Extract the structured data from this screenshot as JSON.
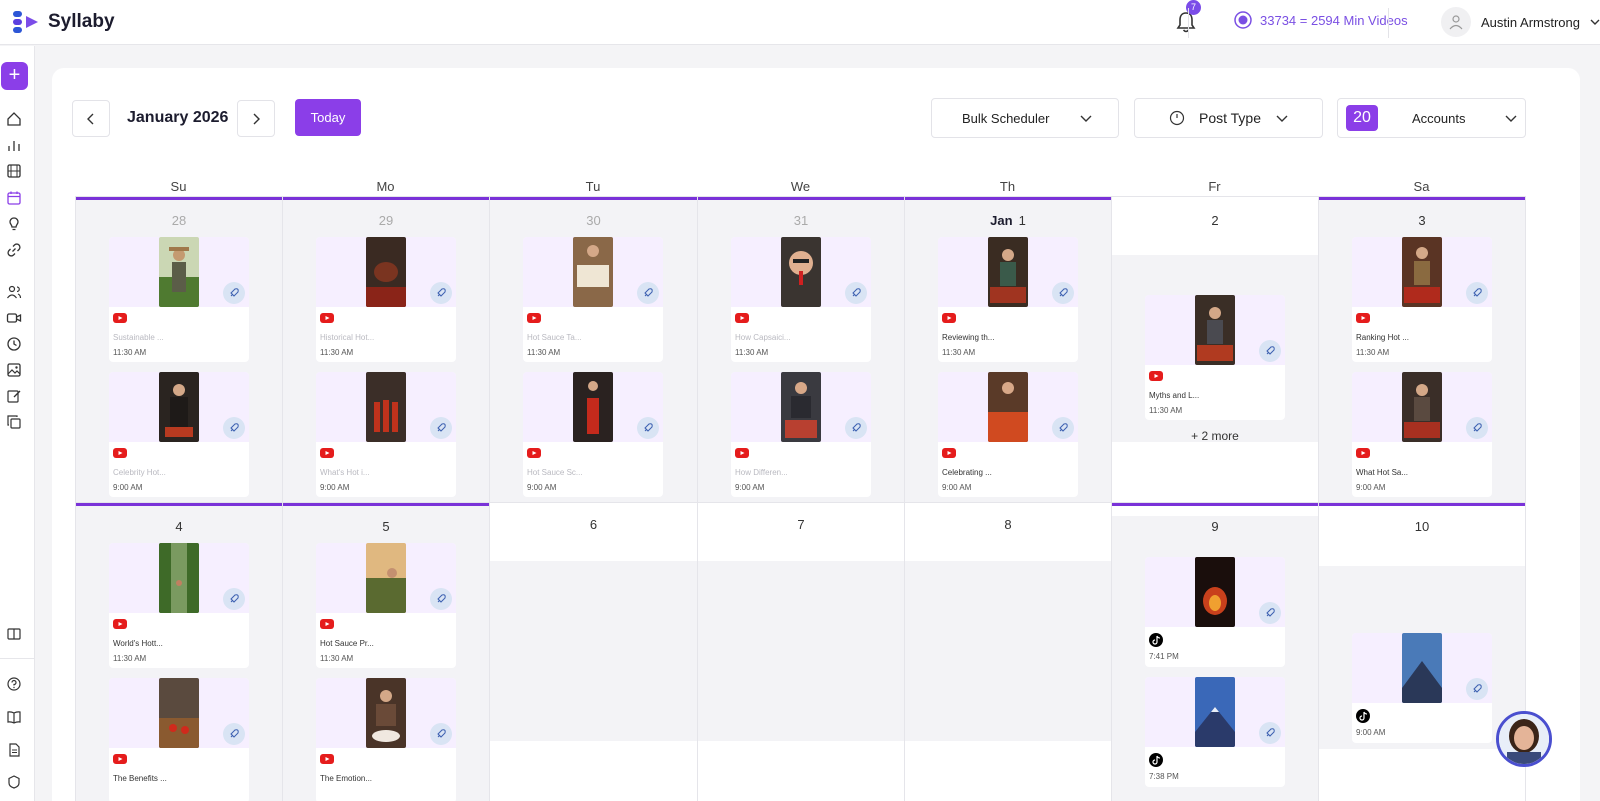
{
  "app": {
    "name": "Syllaby"
  },
  "header": {
    "notification_count": "7",
    "credits_text": "33734 = 2594 Min Videos",
    "user_name": "Austin Armstrong"
  },
  "toolbar": {
    "month": "January 2026",
    "today_label": "Today",
    "bulk_scheduler_label": "Bulk Scheduler",
    "post_type_label": "Post Type",
    "accounts_count": "20",
    "accounts_label": "Accounts"
  },
  "calendar": {
    "weekdays": [
      "Su",
      "Mo",
      "Tu",
      "We",
      "Th",
      "Fr",
      "Sa"
    ],
    "week1": {
      "su": {
        "date": "28",
        "posts": [
          {
            "title": "Sustainable ...",
            "time": "11:30 AM"
          },
          {
            "title": "Celebrity Hot...",
            "time": "9:00 AM"
          }
        ]
      },
      "mo": {
        "date": "29",
        "posts": [
          {
            "title": "Historical Hot...",
            "time": "11:30 AM"
          },
          {
            "title": "What's Hot i...",
            "time": "9:00 AM"
          }
        ]
      },
      "tu": {
        "date": "30",
        "posts": [
          {
            "title": "Hot Sauce Ta...",
            "time": "11:30 AM"
          },
          {
            "title": "Hot Sauce Sc...",
            "time": "9:00 AM"
          }
        ]
      },
      "we": {
        "date": "31",
        "posts": [
          {
            "title": "How Capsaici...",
            "time": "11:30 AM"
          },
          {
            "title": "How Differen...",
            "time": "9:00 AM"
          }
        ]
      },
      "th": {
        "month": "Jan",
        "date": "1",
        "posts": [
          {
            "title": "Reviewing th...",
            "time": "11:30 AM"
          },
          {
            "title": "Celebrating ...",
            "time": "9:00 AM"
          }
        ]
      },
      "fr": {
        "date": "2",
        "more": "+ 2 more",
        "posts": [
          {
            "title": "Myths and L...",
            "time": "11:30 AM"
          }
        ]
      },
      "sa": {
        "date": "3",
        "posts": [
          {
            "title": "Ranking Hot ...",
            "time": "11:30 AM"
          },
          {
            "title": "What Hot Sa...",
            "time": "9:00 AM"
          }
        ]
      }
    },
    "week2": {
      "su": {
        "date": "4",
        "posts": [
          {
            "title": "World's Hott...",
            "time": "11:30 AM"
          },
          {
            "title": "The Benefits ...",
            "time": ""
          }
        ]
      },
      "mo": {
        "date": "5",
        "posts": [
          {
            "title": "Hot Sauce Pr...",
            "time": "11:30 AM"
          },
          {
            "title": "The Emotion...",
            "time": ""
          }
        ]
      },
      "tu": {
        "date": "6"
      },
      "we": {
        "date": "7"
      },
      "th": {
        "date": "8"
      },
      "fr": {
        "date": "9",
        "posts": [
          {
            "time": "7:41 PM"
          },
          {
            "time": "7:38 PM"
          }
        ]
      },
      "sa": {
        "date": "10",
        "posts": [
          {
            "time": "9:00 AM"
          }
        ]
      }
    }
  },
  "colors": {
    "accent": "#8b3ee8",
    "youtube": "#e51c1c",
    "tiktok": "#000000"
  }
}
